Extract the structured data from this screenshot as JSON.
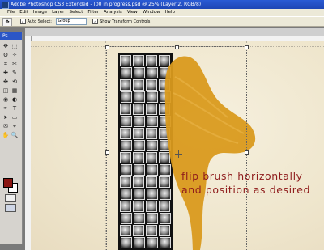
{
  "app": {
    "title": "Adobe Photoshop CS3 Extended - [00 in progress.psd @ 25% (Layer 2, RGB/8)]"
  },
  "menu": [
    "File",
    "Edit",
    "Image",
    "Layer",
    "Select",
    "Filter",
    "Analysis",
    "View",
    "Window",
    "Help"
  ],
  "options": {
    "auto_select_label": "Auto Select:",
    "auto_select_value": "Group",
    "show_transform_label": "Show Transform Controls"
  },
  "toolbox": {
    "logo": "Ps",
    "tools": [
      "move-tool",
      "marquee-tool",
      "lasso-tool",
      "magic-wand-tool",
      "crop-tool",
      "slice-tool",
      "healing-brush-tool",
      "brush-tool",
      "clone-stamp-tool",
      "history-brush-tool",
      "eraser-tool",
      "gradient-tool",
      "blur-tool",
      "dodge-tool",
      "pen-tool",
      "type-tool",
      "path-selection-tool",
      "shape-tool",
      "notes-tool",
      "eyedropper-tool",
      "hand-tool",
      "zoom-tool"
    ],
    "tool_glyphs": [
      "✥",
      "⬚",
      "ʘ",
      "✧",
      "⌗",
      "✂",
      "✚",
      "✎",
      "✤",
      "⟲",
      "◫",
      "▦",
      "◉",
      "◐",
      "✒",
      "T",
      "➤",
      "▭",
      "✉",
      "⌖",
      "✋",
      "🔍"
    ],
    "foreground_color": "#8a1512",
    "background_color": "#ffffff"
  },
  "canvas": {
    "brush_color": "#d99a1e",
    "caption_line1": "flip brush horizontally",
    "caption_line2": "and position as desired",
    "caption_color": "#8f1c1c"
  }
}
